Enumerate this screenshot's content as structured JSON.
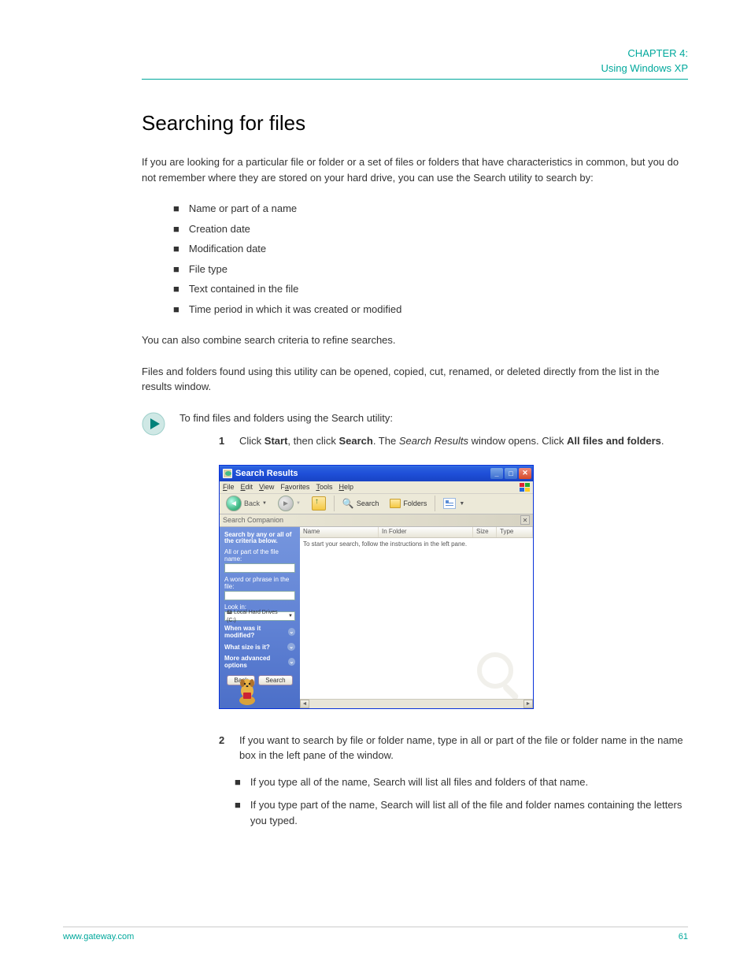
{
  "header": {
    "chapter_label": "CHAPTER 4:",
    "chapter_title": "Using Windows XP"
  },
  "section": {
    "heading": "Searching for files",
    "intro": "If you are looking for a particular file or folder or a set of files or folders that have characteristics in common, but you do not remember where they are stored on your hard drive, you can use the Search utility to search by:",
    "outro": "You can also combine search criteria to refine searches."
  },
  "criteria": [
    "Name or part of a name",
    "Creation date",
    "Modification date",
    "File type",
    "Text contained in the file",
    "Time period in which it was created or modified"
  ],
  "extra_paragraph": "Files and folders found using this utility can be opened, copied, cut, renamed, or deleted directly from the list in the results window.",
  "instruction": {
    "lead": "To find files and folders using the Search utility:",
    "steps": {
      "s1": {
        "num": "1",
        "text_a": "Click ",
        "start": "Start",
        "text_b": ", then click ",
        "search": "Search",
        "text_c": ". The ",
        "results_italic": "Search Results",
        "text_d": " window opens. Click ",
        "allfiles": "All files and folders",
        "text_e": "."
      },
      "s2": {
        "num": "2",
        "text_a": "If you want to search by file or folder name, type in all or part of the file or folder name in the name box in the left pane of the window."
      }
    },
    "sub_bullets": {
      "b1": "If you type all of the name, Search will list all files and folders of that name.",
      "b2": "If you type part of the name, Search will list all of the file and folder names containing the letters you typed."
    }
  },
  "screenshot": {
    "title": "Search Results",
    "menu": [
      "File",
      "Edit",
      "View",
      "Favorites",
      "Tools",
      "Help"
    ],
    "toolbar": {
      "back": "Back",
      "search": "Search",
      "folders": "Folders"
    },
    "companion_label": "Search Companion",
    "columns": {
      "name": "Name",
      "in_folder": "In Folder",
      "size": "Size",
      "type": "Type"
    },
    "hint": "To start your search, follow the instructions in the left pane.",
    "pane": {
      "heading": "Search by any or all of the criteria below.",
      "label_name": "All or part of the file name:",
      "label_phrase": "A word or phrase in the file:",
      "label_lookin": "Look in:",
      "lookin_value": "Local Hard Drives (C:)",
      "expand_modified": "When was it modified?",
      "expand_size": "What size is it?",
      "expand_more": "More advanced options",
      "btn_back": "Back",
      "btn_search": "Search"
    }
  },
  "footer": {
    "left": "www.gateway.com",
    "right": "61"
  }
}
